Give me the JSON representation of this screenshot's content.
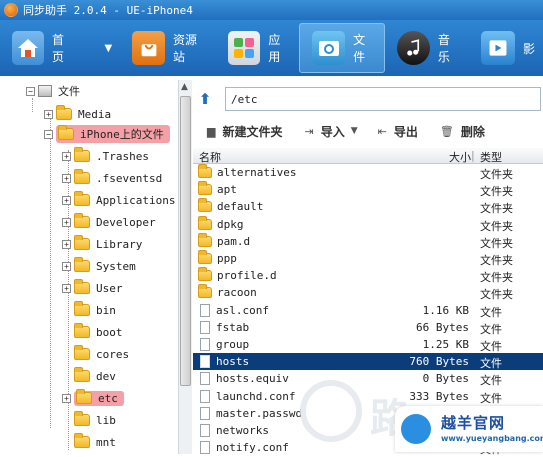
{
  "window": {
    "title": "同步助手 2.0.4 - UE-iPhone4"
  },
  "toolbar": {
    "items": [
      {
        "label": "首页",
        "icon": "home-icon"
      },
      {
        "label": "资源站",
        "icon": "shopping-bag-icon"
      },
      {
        "label": "应用",
        "icon": "apps-icon"
      },
      {
        "label": "文件",
        "icon": "files-icon",
        "active": true
      },
      {
        "label": "音乐",
        "icon": "music-icon"
      },
      {
        "label": "影",
        "icon": "video-icon"
      }
    ]
  },
  "tree": {
    "root": "文件",
    "media": "Media",
    "iphone_files": "iPhone上的文件",
    "children": [
      ".Trashes",
      ".fseventsd",
      "Applications",
      "Developer",
      "Library",
      "System",
      "User",
      "bin",
      "boot",
      "cores",
      "dev",
      "etc",
      "lib",
      "mnt"
    ]
  },
  "path": {
    "value": "/etc"
  },
  "actions": {
    "new_folder": "新建文件夹",
    "import": "导入",
    "export": "导出",
    "delete": "删除"
  },
  "columns": {
    "name": "名称",
    "size": "大小",
    "type": "类型"
  },
  "files": [
    {
      "name": "alternatives",
      "size": "",
      "type": "文件夹",
      "kind": "folder"
    },
    {
      "name": "apt",
      "size": "",
      "type": "文件夹",
      "kind": "folder"
    },
    {
      "name": "default",
      "size": "",
      "type": "文件夹",
      "kind": "folder"
    },
    {
      "name": "dpkg",
      "size": "",
      "type": "文件夹",
      "kind": "folder"
    },
    {
      "name": "pam.d",
      "size": "",
      "type": "文件夹",
      "kind": "folder"
    },
    {
      "name": "ppp",
      "size": "",
      "type": "文件夹",
      "kind": "folder"
    },
    {
      "name": "profile.d",
      "size": "",
      "type": "文件夹",
      "kind": "folder"
    },
    {
      "name": "racoon",
      "size": "",
      "type": "文件夹",
      "kind": "folder"
    },
    {
      "name": "asl.conf",
      "size": "1.16 KB",
      "type": "文件",
      "kind": "file"
    },
    {
      "name": "fstab",
      "size": "66 Bytes",
      "type": "文件",
      "kind": "file"
    },
    {
      "name": "group",
      "size": "1.25 KB",
      "type": "文件",
      "kind": "file"
    },
    {
      "name": "hosts",
      "size": "760 Bytes",
      "type": "文件",
      "kind": "file",
      "selected": true
    },
    {
      "name": "hosts.equiv",
      "size": "0 Bytes",
      "type": "文件",
      "kind": "file"
    },
    {
      "name": "launchd.conf",
      "size": "333 Bytes",
      "type": "文件",
      "kind": "file"
    },
    {
      "name": "master.passwd",
      "size": "",
      "type": "文件",
      "kind": "file"
    },
    {
      "name": "networks",
      "size": "",
      "type": "文件",
      "kind": "file"
    },
    {
      "name": "notify.conf",
      "size": "",
      "type": "文件",
      "kind": "file"
    }
  ],
  "watermark": {
    "big_text": "路",
    "brand": "越羊官网",
    "url": "www.yueyangbang.com"
  },
  "colors": {
    "toolbar_blue": "#1f6fbf",
    "highlight": "#f5a0a6",
    "selected_row": "#0b3d7a"
  }
}
